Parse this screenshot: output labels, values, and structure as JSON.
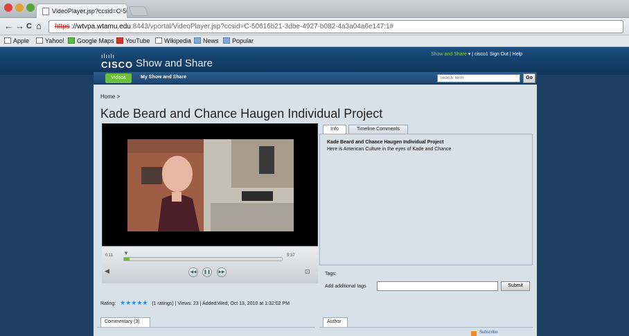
{
  "browser": {
    "tab_title": "VideoPlayer.jsp?ccsid=C-50",
    "tab_close": "×",
    "url_scheme": "https",
    "url_host": "://wtvpa.wtamu.edu",
    "url_rest": ":8443/vportal/VideoPlayer.jsp?ccsid=C-50616b21-3dbe-4927-b082-4a3a04a6e147:1#",
    "back": "←",
    "forward": "→",
    "reload": "C",
    "home": "⌂",
    "bookmarks": [
      "Apple",
      "Yahoo!",
      "Google Maps",
      "YouTube",
      "Wikipedia",
      "News",
      "Popular"
    ]
  },
  "header": {
    "cisco_bars": "ılıılı",
    "cisco_word": "CISCO",
    "app_title": "Show and Share",
    "user_menu": "Show and Share",
    "user_links": "▾  |  cisco1 Sign Out  |  Help"
  },
  "nav": {
    "videos": "Videos",
    "my_show_and_share": "My Show and Share",
    "search_placeholder": "Search Term",
    "go": "Go"
  },
  "main": {
    "breadcrumb": "Home >",
    "title": "Kade Beard and Chance Haugen Individual Project"
  },
  "player": {
    "elapsed": "0:11",
    "duration": "5:37",
    "progress": 0.033,
    "rewind_icon": "◀◀",
    "pause_icon": "❚❚",
    "forward_icon": "▶▶",
    "volume_icon": "◀",
    "fullscreen_icon": "⊡"
  },
  "tabs": {
    "info": "Info",
    "timeline": "Timeline Comments"
  },
  "info": {
    "title": "Kade Beard and Chance Haugen Individual Project",
    "description": "Here is American Culture in the eyes of Kade and Chance"
  },
  "tags": {
    "label": "Tags:",
    "add_label": "Add additional tags",
    "submit": "Submit"
  },
  "rating": {
    "label": "Rating:",
    "stars": "★★★★★",
    "details": "(1 ratings) | Views: 23 | Added:Wed, Oct 13, 2010 at 1:32:02 PM"
  },
  "lower": {
    "commentary_tab": "Commentary (3)",
    "author_tab": "Author",
    "subscribe": "Subscribe"
  },
  "colors": {
    "accent_green": "#6cbf3c",
    "banner_blue": "#1a4d80",
    "star_blue": "#2f8de4"
  }
}
